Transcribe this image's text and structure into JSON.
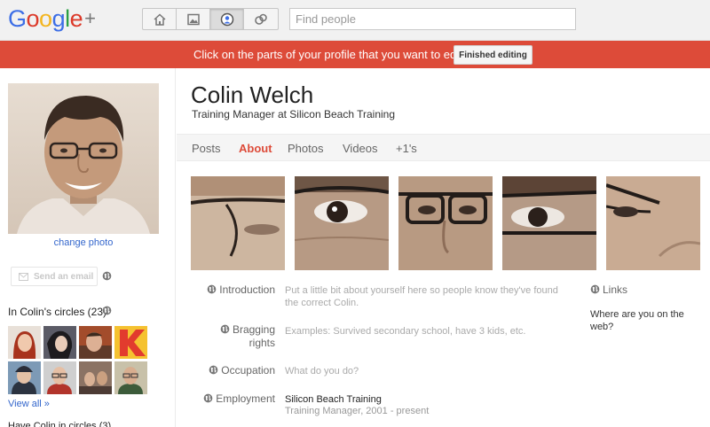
{
  "logo": {
    "brand": "Google+",
    "letters": [
      "G",
      "o",
      "o",
      "g",
      "l",
      "e"
    ],
    "plus": "+"
  },
  "nav": {
    "buttons": [
      {
        "icon": "home-icon"
      },
      {
        "icon": "photos-icon"
      },
      {
        "icon": "profile-icon",
        "active": true
      },
      {
        "icon": "circles-icon"
      }
    ]
  },
  "search": {
    "placeholder": "Find people",
    "value": ""
  },
  "edit_banner": {
    "message": "Click on the parts of your profile that you want to edit.",
    "button_label": "Finished editing",
    "color": "#dd4b39"
  },
  "sidebar": {
    "change_photo": "change photo",
    "send_email": "Send an email",
    "circles_title": "In Colin's circles (23)",
    "view_all": "View all »",
    "have_circles_text": "Have Colin in circles (3)"
  },
  "profile": {
    "name": "Colin Welch",
    "tagline": "Training Manager at Silicon Beach Training"
  },
  "tabs": [
    {
      "label": "Posts",
      "active": false
    },
    {
      "label": "About",
      "active": true
    },
    {
      "label": "Photos",
      "active": false
    },
    {
      "label": "Videos",
      "active": false
    },
    {
      "label": "+1's",
      "active": false
    }
  ],
  "about": {
    "fields": [
      {
        "label_line1": "Introduction",
        "label_line2": "",
        "value": "Put a little bit about yourself here so people know they've found the correct Colin."
      },
      {
        "label_line1": "Bragging",
        "label_line2": "rights",
        "value": "Examples: Survived secondary school, have 3 kids, etc."
      },
      {
        "label_line1": "Occupation",
        "label_line2": "",
        "value": "What do you do?"
      },
      {
        "label_line1": "Employment",
        "label_line2": "",
        "value": "Silicon Beach Training",
        "sub": "Training Manager, 2001 - present"
      }
    ],
    "links_label": "Links",
    "links_prompt": "Where are you on the web?"
  },
  "colors": {
    "accent_red": "#dd4b39",
    "link_blue": "#3366cc"
  }
}
